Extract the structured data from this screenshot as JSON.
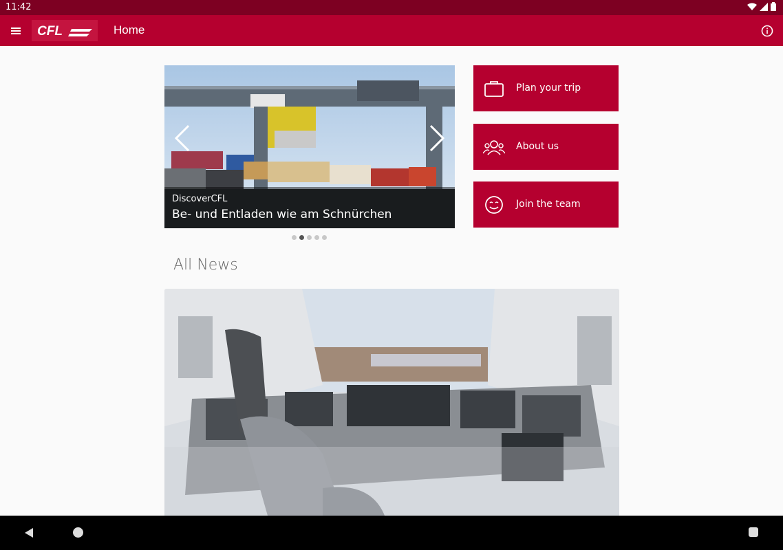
{
  "status_bar": {
    "time": "11:42"
  },
  "app_bar": {
    "title": "Home",
    "logo_text": "CFL"
  },
  "carousel": {
    "kicker": "DiscoverCFL",
    "headline": "Be- und Entladen wie am Schnürchen",
    "slide_count": 5,
    "active_index": 1
  },
  "tiles": [
    {
      "label": "Plan your trip",
      "icon": "briefcase-icon"
    },
    {
      "label": "About us",
      "icon": "team-icon"
    },
    {
      "label": "Join the team",
      "icon": "smiley-icon"
    }
  ],
  "news": {
    "section_title": "All News"
  },
  "colors": {
    "brand": "#b5002f",
    "status_bar": "#7d0022"
  }
}
